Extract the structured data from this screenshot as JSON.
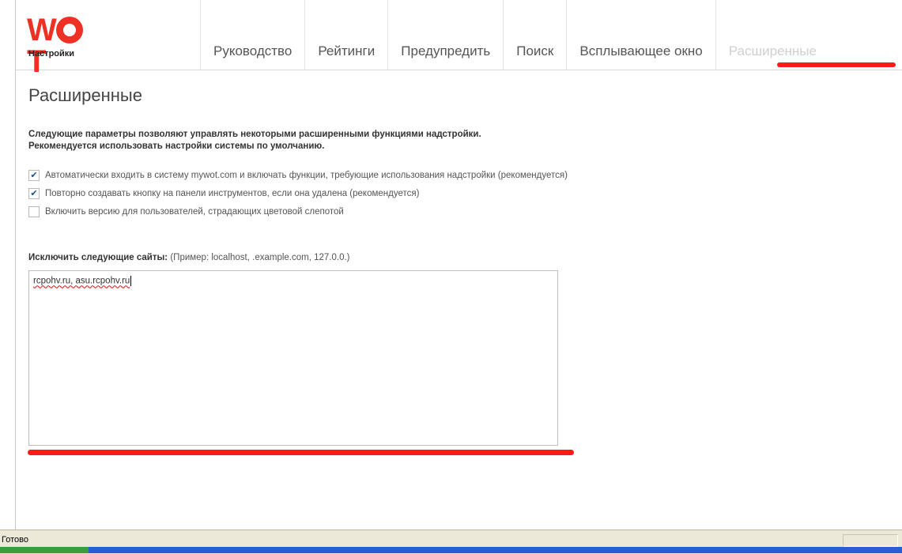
{
  "logo": {
    "brand": "WOT",
    "subtitle": "Настройки"
  },
  "tabs": [
    {
      "label": "Руководство"
    },
    {
      "label": "Рейтинги"
    },
    {
      "label": "Предупредить"
    },
    {
      "label": "Поиск"
    },
    {
      "label": "Всплывающее окно"
    },
    {
      "label": "Расширенные",
      "active": true
    }
  ],
  "page": {
    "title": "Расширенные",
    "description_line1": "Следующие параметры позволяют управлять некоторыми расширенными функциями надстройки.",
    "description_line2": "Рекомендуется использовать настройки системы по умолчанию.",
    "options": [
      {
        "label": "Автоматически входить в систему mywot.com и включать функции, требующие использования надстройки (рекомендуется)",
        "checked": true
      },
      {
        "label": "Повторно создавать кнопку на панели инструментов, если она удалена (рекомендуется)",
        "checked": true
      },
      {
        "label": "Включить версию для пользователей, страдающих цветовой слепотой",
        "checked": false
      }
    ],
    "exclude_label": "Исключить следующие сайты:",
    "exclude_hint": "(Пример: localhost, .example.com, 127.0.0.)",
    "exclude_value": "rcpohv.ru, asu.rcpohv.ru"
  },
  "status": {
    "text": "Готово"
  },
  "colors": {
    "accent": "#ee3124",
    "annotation": "#ff1a1a"
  }
}
